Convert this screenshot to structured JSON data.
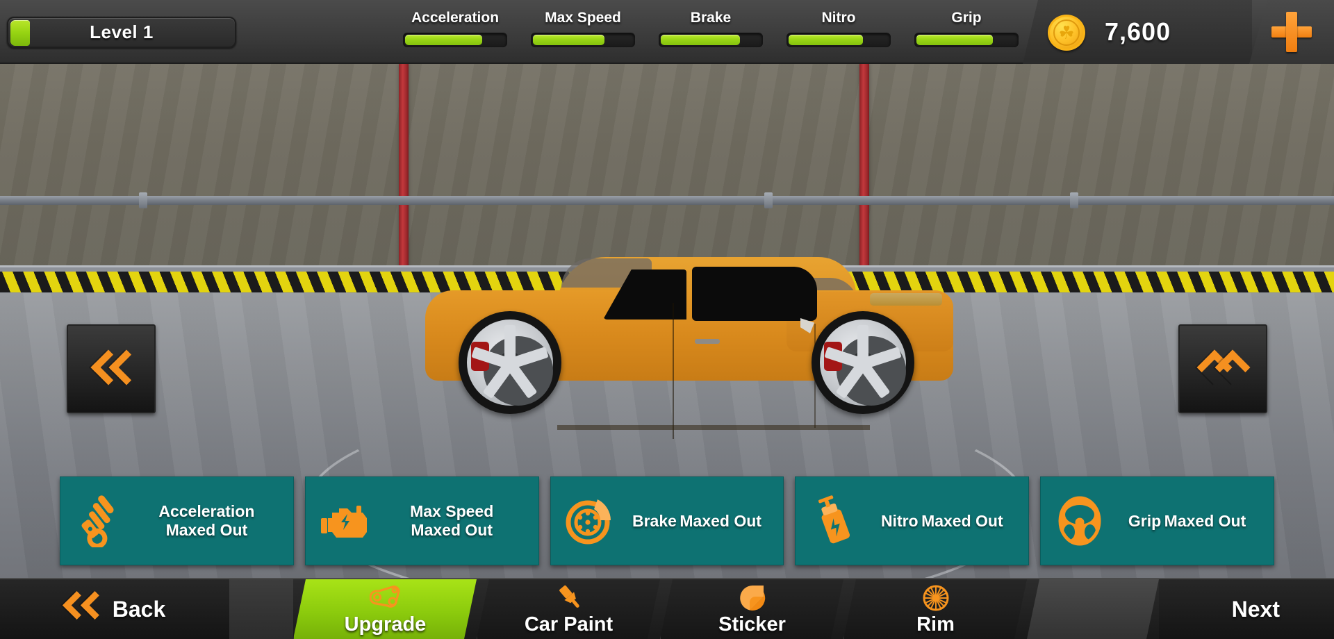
{
  "topbar": {
    "level": {
      "label": "Level 1",
      "fill_percent": 8
    },
    "stats": [
      {
        "name": "Acceleration",
        "label": "Acceleration",
        "fill_percent": 78
      },
      {
        "name": "Max Speed",
        "label": "Max Speed",
        "fill_percent": 72
      },
      {
        "name": "Brake",
        "label": "Brake",
        "fill_percent": 80
      },
      {
        "name": "Nitro",
        "label": "Nitro",
        "fill_percent": 75
      },
      {
        "name": "Grip",
        "label": "Grip",
        "fill_percent": 77
      }
    ],
    "currency": {
      "amount": "7,600",
      "icon": "coin-icon",
      "coin_glyph": "☘"
    },
    "add_currency": {
      "icon": "plus-icon",
      "label": "+"
    }
  },
  "scene": {
    "prev_car": {
      "icon": "double-chevron-left-icon"
    },
    "next_car": {
      "icon": "double-chevron-right-icon"
    },
    "car": {
      "name": "orange-muscle-car",
      "body_color": "#d98a1d"
    },
    "pillar_color": "#b33236",
    "floor_color": "#8b8e93",
    "wall_color": "#706c60"
  },
  "upgrade_cards": [
    {
      "title": "Acceleration",
      "status": "Maxed Out",
      "icon": "shock-absorber-icon"
    },
    {
      "title": "Max Speed",
      "status": "Maxed Out",
      "icon": "engine-icon"
    },
    {
      "title": "Brake",
      "status": "Maxed Out",
      "icon": "brake-disc-icon"
    },
    {
      "title": "Nitro",
      "status": "Maxed Out",
      "icon": "nitro-bottle-icon"
    },
    {
      "title": "Grip",
      "status": "Maxed Out",
      "icon": "steering-wheel-icon"
    }
  ],
  "bottomnav": {
    "back": {
      "label": "Back",
      "icon": "double-chevron-left-icon"
    },
    "tabs": [
      {
        "label": "Upgrade",
        "icon": "timing-belt-icon",
        "active": true
      },
      {
        "label": "Car Paint",
        "icon": "paint-brush-icon",
        "active": false
      },
      {
        "label": "Sticker",
        "icon": "sticker-icon",
        "active": false
      },
      {
        "label": "Rim",
        "icon": "wheel-rim-icon",
        "active": false
      }
    ],
    "next": {
      "label": "Next"
    }
  },
  "colors": {
    "accent_green": "#9ad616",
    "accent_orange": "#f59020",
    "card_teal": "#0e7272",
    "coin_gold": "#fec22a"
  }
}
